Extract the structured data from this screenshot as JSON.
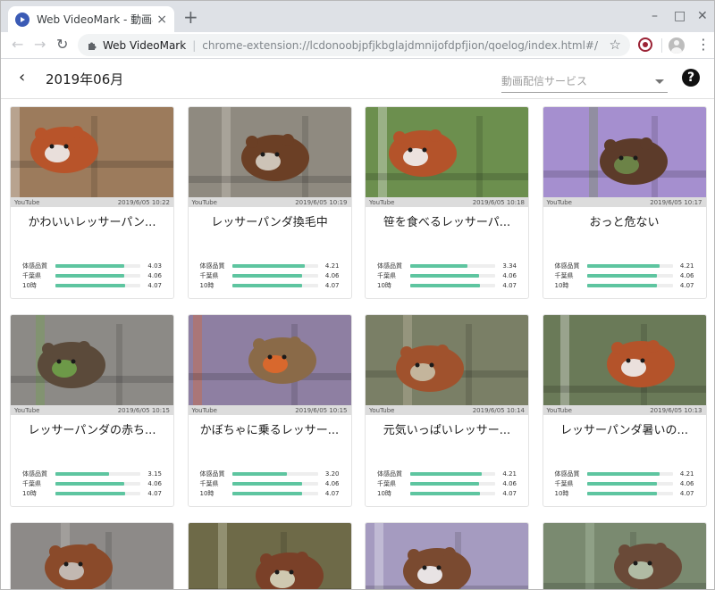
{
  "browser": {
    "tab_title": "Web VideoMark - 動画再生",
    "tab_close": "×",
    "new_tab": "+",
    "window_controls": [
      "–",
      "□",
      "✕"
    ],
    "nav": {
      "back": "←",
      "forward": "→",
      "reload": "↻"
    },
    "omnibox": {
      "site": "Web VideoMark",
      "separator": "|",
      "url": "chrome-extension://lcdonoobjpfjkbglajdmnijofdpfjion/qoelog/index.html#/"
    },
    "star": "☆",
    "menu": "⋮"
  },
  "header": {
    "back": "‹",
    "title": "2019年06月",
    "service_placeholder": "動画配信サービス",
    "help": "?"
  },
  "quality_labels": [
    "体感品質",
    "千葉県",
    "10時"
  ],
  "quality_max": 5,
  "cards": [
    {
      "service": "YouTube",
      "date": "2019/6/05 10:22",
      "title": "かわいいレッサーパン...",
      "q": [
        "4.03",
        "4.06",
        "4.07"
      ],
      "thumb": {
        "bg": "#9c7b5c",
        "fg": "#b8542a",
        "accent": "#eeeeee"
      }
    },
    {
      "service": "YouTube",
      "date": "2019/6/05 10:19",
      "title": "レッサーパンダ換毛中",
      "q": [
        "4.21",
        "4.06",
        "4.07"
      ],
      "thumb": {
        "bg": "#8f8a80",
        "fg": "#6b3f25",
        "accent": "#d8d2c8"
      }
    },
    {
      "service": "YouTube",
      "date": "2019/6/05 10:18",
      "title": "笹を食べるレッサーパ...",
      "q": [
        "3.34",
        "4.06",
        "4.07"
      ],
      "thumb": {
        "bg": "#6c8f4e",
        "fg": "#b4532a",
        "accent": "#f2f2f2"
      }
    },
    {
      "service": "YouTube",
      "date": "2019/6/05 10:17",
      "title": "おっと危ない",
      "q": [
        "4.21",
        "4.06",
        "4.07"
      ],
      "thumb": {
        "bg": "#a58fcf",
        "fg": "#5c3b2a",
        "accent": "#6e8c4a"
      }
    },
    {
      "service": "YouTube",
      "date": "2019/6/05 10:15",
      "title": "レッサーパンダの赤ち...",
      "q": [
        "3.15",
        "4.06",
        "4.07"
      ],
      "thumb": {
        "bg": "#8c8a86",
        "fg": "#5b4a3a",
        "accent": "#6fa24a"
      }
    },
    {
      "service": "YouTube",
      "date": "2019/6/05 10:15",
      "title": "かぼちゃに乗るレッサー...",
      "q": [
        "3.20",
        "4.06",
        "4.07"
      ],
      "thumb": {
        "bg": "#8e7fa2",
        "fg": "#8a6a48",
        "accent": "#e0682a"
      }
    },
    {
      "service": "YouTube",
      "date": "2019/6/05 10:14",
      "title": "元気いっぱいレッサー...",
      "q": [
        "4.21",
        "4.06",
        "4.07"
      ],
      "thumb": {
        "bg": "#7a7f66",
        "fg": "#a0522d",
        "accent": "#c8c0a8"
      }
    },
    {
      "service": "YouTube",
      "date": "2019/6/05 10:13",
      "title": "レッサーパンダ暑いの...",
      "q": [
        "4.21",
        "4.06",
        "4.07"
      ],
      "thumb": {
        "bg": "#6a7a58",
        "fg": "#b4532a",
        "accent": "#f0f0f0"
      }
    },
    {
      "thumb": {
        "bg": "#8d8a88",
        "fg": "#8a4a2a",
        "accent": "#c8c4c0"
      }
    },
    {
      "thumb": {
        "bg": "#6e6a48",
        "fg": "#7a4028",
        "accent": "#d8d8c0"
      }
    },
    {
      "thumb": {
        "bg": "#a59bc0",
        "fg": "#7a4a30",
        "accent": "#f4f4f8"
      }
    },
    {
      "thumb": {
        "bg": "#7a8a70",
        "fg": "#6a4a38",
        "accent": "#b8c8b0"
      }
    }
  ]
}
